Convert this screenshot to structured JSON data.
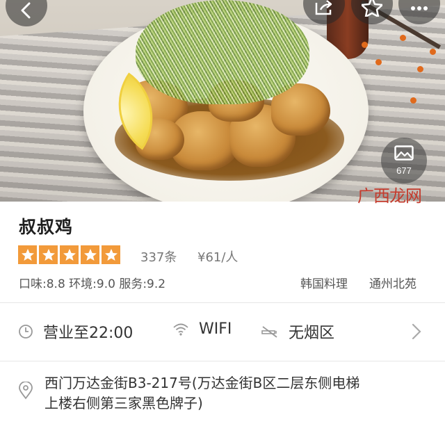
{
  "hero": {
    "photo_count": "677"
  },
  "shop": {
    "name": "叔叔鸡",
    "rating_stars": 5,
    "review_count": "337条",
    "price": "¥61/人",
    "scores": "口味:8.8  环境:9.0  服务:9.2",
    "cuisine": "韩国料理",
    "district": "通州北苑"
  },
  "amenities": {
    "hours": "营业至22:00",
    "wifi": "WIFI",
    "no_smoking": "无烟区"
  },
  "address": {
    "text": "西门万达金街B3-217号(万达金街B区二层东侧电梯上楼右侧第三家黑色牌子)"
  },
  "watermark": "广西龙网",
  "colors": {
    "star_orange": "#f29a3a",
    "text_dark": "#222222",
    "text_gray": "#777777",
    "divider": "#e6e6e6",
    "watermark_red": "#c43b2d"
  },
  "icons": {
    "back": "chevron-left-icon",
    "share": "share-icon",
    "favorite": "star-outline-icon",
    "more": "more-dots-icon",
    "photos": "image-icon",
    "hours": "clock-icon",
    "wifi": "wifi-icon",
    "no_smoking": "no-smoking-icon",
    "expand": "chevron-right-icon",
    "location": "location-pin-icon"
  }
}
